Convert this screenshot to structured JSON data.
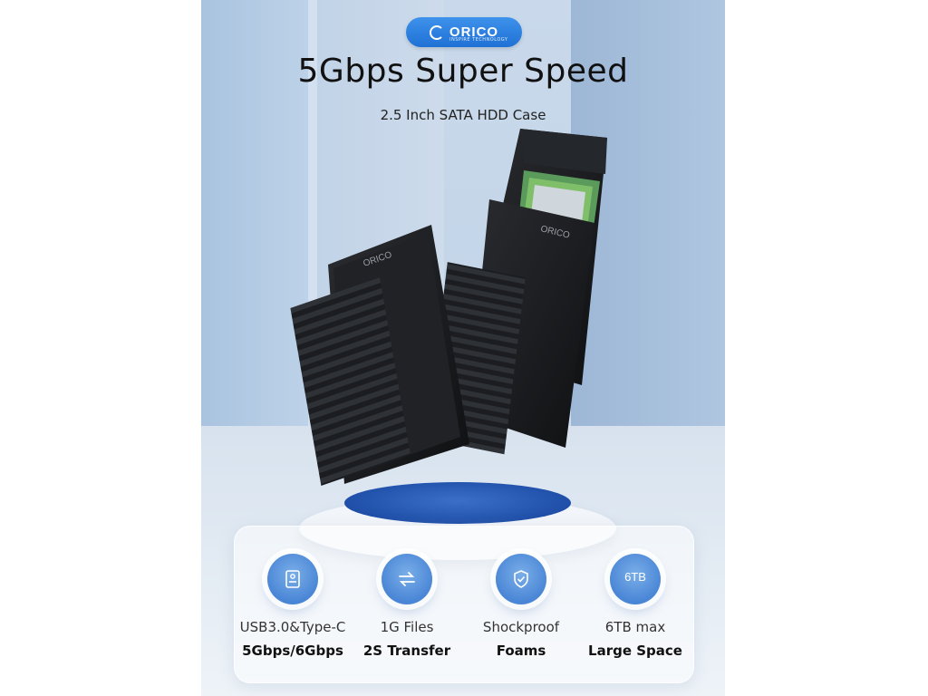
{
  "brand": {
    "name": "ORICO",
    "tagline": "INSPIRE TECHNOLOGY"
  },
  "headline": "5Gbps Super Speed",
  "subheadline": "2.5 Inch SATA HDD Case",
  "product": {
    "logo_text": "ORICO"
  },
  "colors": {
    "accent": "#2a7be0",
    "pedestal": "#2c5fb8",
    "text": "#111111"
  },
  "features": [
    {
      "icon": "hard-drive-icon",
      "line1": "USB3.0&Type-C",
      "line2": "5Gbps/6Gbps"
    },
    {
      "icon": "transfer-arrows-icon",
      "line1": "1G Files",
      "line2": "2S Transfer"
    },
    {
      "icon": "shield-check-icon",
      "line1": "Shockproof",
      "line2": "Foams"
    },
    {
      "icon": "capacity-6tb-icon",
      "icon_text": "6TB",
      "line1": "6TB max",
      "line2": "Large Space"
    }
  ]
}
